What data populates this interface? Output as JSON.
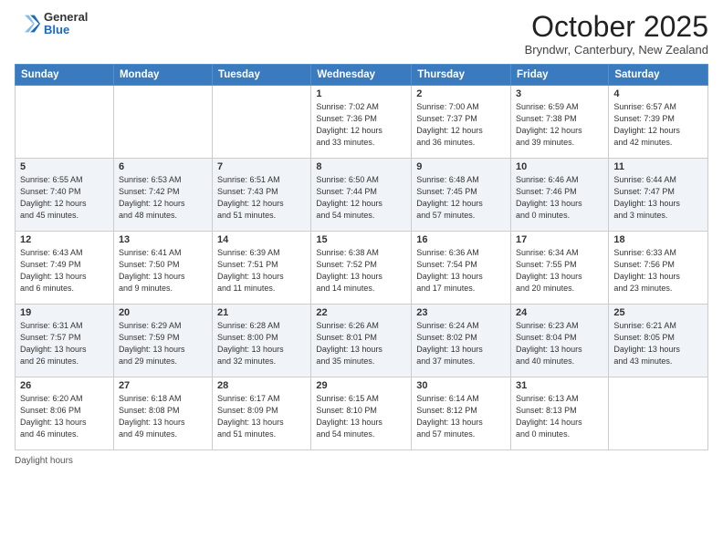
{
  "header": {
    "logo_general": "General",
    "logo_blue": "Blue",
    "month_title": "October 2025",
    "location": "Bryndwr, Canterbury, New Zealand"
  },
  "weekdays": [
    "Sunday",
    "Monday",
    "Tuesday",
    "Wednesday",
    "Thursday",
    "Friday",
    "Saturday"
  ],
  "footer": {
    "daylight_hours": "Daylight hours"
  },
  "weeks": [
    [
      {
        "day": "",
        "info": ""
      },
      {
        "day": "",
        "info": ""
      },
      {
        "day": "",
        "info": ""
      },
      {
        "day": "1",
        "info": "Sunrise: 7:02 AM\nSunset: 7:36 PM\nDaylight: 12 hours\nand 33 minutes."
      },
      {
        "day": "2",
        "info": "Sunrise: 7:00 AM\nSunset: 7:37 PM\nDaylight: 12 hours\nand 36 minutes."
      },
      {
        "day": "3",
        "info": "Sunrise: 6:59 AM\nSunset: 7:38 PM\nDaylight: 12 hours\nand 39 minutes."
      },
      {
        "day": "4",
        "info": "Sunrise: 6:57 AM\nSunset: 7:39 PM\nDaylight: 12 hours\nand 42 minutes."
      }
    ],
    [
      {
        "day": "5",
        "info": "Sunrise: 6:55 AM\nSunset: 7:40 PM\nDaylight: 12 hours\nand 45 minutes."
      },
      {
        "day": "6",
        "info": "Sunrise: 6:53 AM\nSunset: 7:42 PM\nDaylight: 12 hours\nand 48 minutes."
      },
      {
        "day": "7",
        "info": "Sunrise: 6:51 AM\nSunset: 7:43 PM\nDaylight: 12 hours\nand 51 minutes."
      },
      {
        "day": "8",
        "info": "Sunrise: 6:50 AM\nSunset: 7:44 PM\nDaylight: 12 hours\nand 54 minutes."
      },
      {
        "day": "9",
        "info": "Sunrise: 6:48 AM\nSunset: 7:45 PM\nDaylight: 12 hours\nand 57 minutes."
      },
      {
        "day": "10",
        "info": "Sunrise: 6:46 AM\nSunset: 7:46 PM\nDaylight: 13 hours\nand 0 minutes."
      },
      {
        "day": "11",
        "info": "Sunrise: 6:44 AM\nSunset: 7:47 PM\nDaylight: 13 hours\nand 3 minutes."
      }
    ],
    [
      {
        "day": "12",
        "info": "Sunrise: 6:43 AM\nSunset: 7:49 PM\nDaylight: 13 hours\nand 6 minutes."
      },
      {
        "day": "13",
        "info": "Sunrise: 6:41 AM\nSunset: 7:50 PM\nDaylight: 13 hours\nand 9 minutes."
      },
      {
        "day": "14",
        "info": "Sunrise: 6:39 AM\nSunset: 7:51 PM\nDaylight: 13 hours\nand 11 minutes."
      },
      {
        "day": "15",
        "info": "Sunrise: 6:38 AM\nSunset: 7:52 PM\nDaylight: 13 hours\nand 14 minutes."
      },
      {
        "day": "16",
        "info": "Sunrise: 6:36 AM\nSunset: 7:54 PM\nDaylight: 13 hours\nand 17 minutes."
      },
      {
        "day": "17",
        "info": "Sunrise: 6:34 AM\nSunset: 7:55 PM\nDaylight: 13 hours\nand 20 minutes."
      },
      {
        "day": "18",
        "info": "Sunrise: 6:33 AM\nSunset: 7:56 PM\nDaylight: 13 hours\nand 23 minutes."
      }
    ],
    [
      {
        "day": "19",
        "info": "Sunrise: 6:31 AM\nSunset: 7:57 PM\nDaylight: 13 hours\nand 26 minutes."
      },
      {
        "day": "20",
        "info": "Sunrise: 6:29 AM\nSunset: 7:59 PM\nDaylight: 13 hours\nand 29 minutes."
      },
      {
        "day": "21",
        "info": "Sunrise: 6:28 AM\nSunset: 8:00 PM\nDaylight: 13 hours\nand 32 minutes."
      },
      {
        "day": "22",
        "info": "Sunrise: 6:26 AM\nSunset: 8:01 PM\nDaylight: 13 hours\nand 35 minutes."
      },
      {
        "day": "23",
        "info": "Sunrise: 6:24 AM\nSunset: 8:02 PM\nDaylight: 13 hours\nand 37 minutes."
      },
      {
        "day": "24",
        "info": "Sunrise: 6:23 AM\nSunset: 8:04 PM\nDaylight: 13 hours\nand 40 minutes."
      },
      {
        "day": "25",
        "info": "Sunrise: 6:21 AM\nSunset: 8:05 PM\nDaylight: 13 hours\nand 43 minutes."
      }
    ],
    [
      {
        "day": "26",
        "info": "Sunrise: 6:20 AM\nSunset: 8:06 PM\nDaylight: 13 hours\nand 46 minutes."
      },
      {
        "day": "27",
        "info": "Sunrise: 6:18 AM\nSunset: 8:08 PM\nDaylight: 13 hours\nand 49 minutes."
      },
      {
        "day": "28",
        "info": "Sunrise: 6:17 AM\nSunset: 8:09 PM\nDaylight: 13 hours\nand 51 minutes."
      },
      {
        "day": "29",
        "info": "Sunrise: 6:15 AM\nSunset: 8:10 PM\nDaylight: 13 hours\nand 54 minutes."
      },
      {
        "day": "30",
        "info": "Sunrise: 6:14 AM\nSunset: 8:12 PM\nDaylight: 13 hours\nand 57 minutes."
      },
      {
        "day": "31",
        "info": "Sunrise: 6:13 AM\nSunset: 8:13 PM\nDaylight: 14 hours\nand 0 minutes."
      },
      {
        "day": "",
        "info": ""
      }
    ]
  ]
}
